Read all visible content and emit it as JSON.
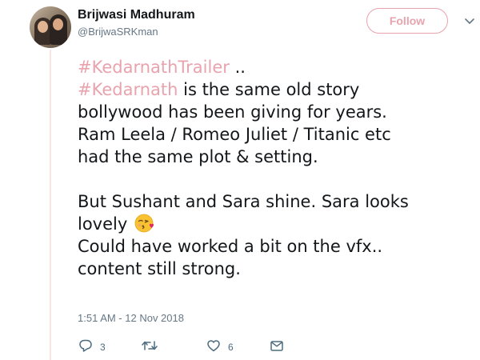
{
  "user": {
    "display_name": "Brijwasi Madhuram",
    "handle": "@BrijwaSRKman"
  },
  "follow_label": "Follow",
  "tweet": {
    "lines": [
      {
        "hashtag": "#KedarnathTrailer",
        "rest": " .."
      },
      {
        "hashtag": "#Kedarnath",
        "rest": " is the same old story"
      },
      {
        "text": "bollywood has been giving for years."
      },
      {
        "text": "Ram Leela / Romeo Juliet / Titanic etc"
      },
      {
        "text": "had the same plot & setting."
      },
      {
        "text": "But Sushant and Sara shine. Sara looks"
      },
      {
        "text": "lovely",
        "emoji": "face-blowing-kiss-emoji"
      },
      {
        "text": "Could have worked a bit on the vfx.."
      },
      {
        "text": "content still strong."
      }
    ]
  },
  "timestamp": "1:51 AM - 12 Nov 2018",
  "actions": {
    "reply_count": "3",
    "retweet_count": "",
    "like_count": "6"
  },
  "colors": {
    "accent": "#e8a3ad",
    "text": "#14171a",
    "secondary": "#657786"
  }
}
